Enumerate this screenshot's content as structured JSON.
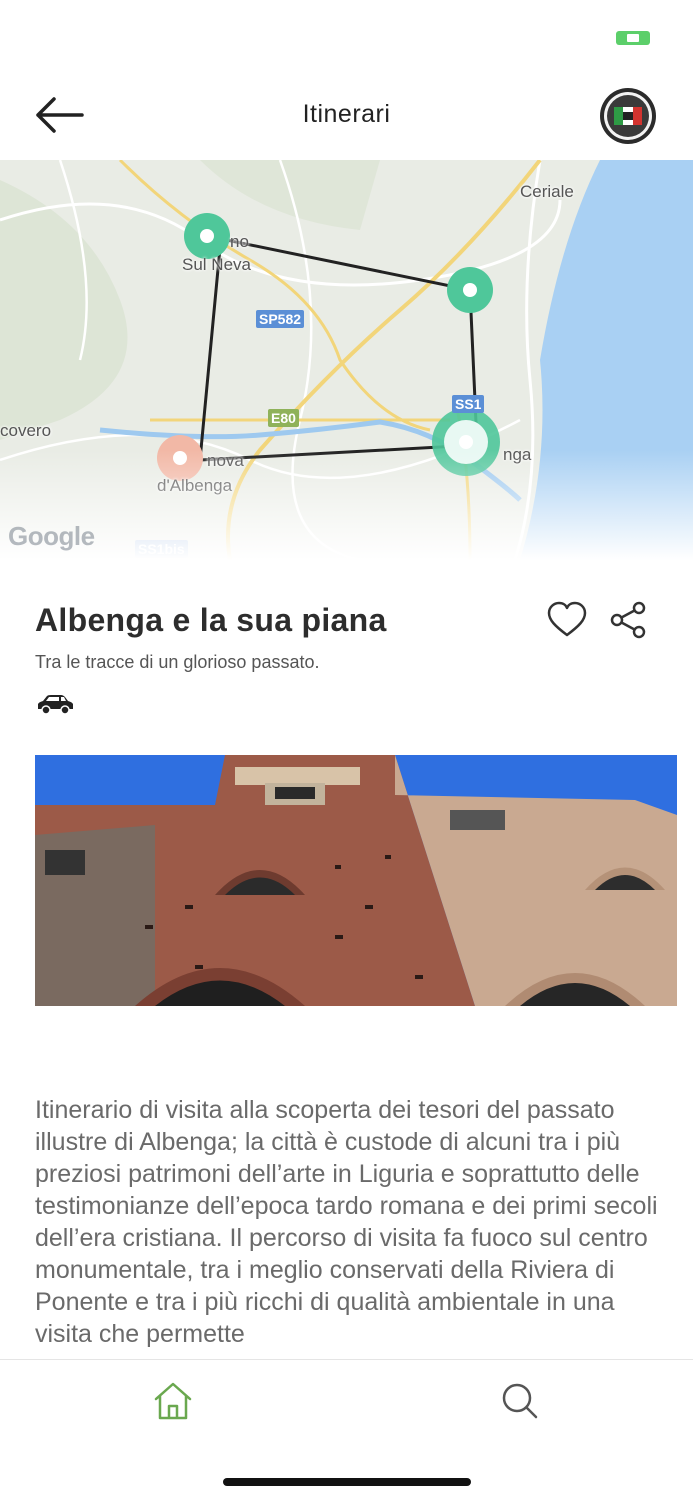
{
  "header": {
    "title": "Itinerari",
    "back_icon": "arrow-left-icon",
    "logo_icon": "italian-flag-logo-icon"
  },
  "status_bar": {
    "battery_icon": "battery-icon",
    "battery_color": "#5ccf6a"
  },
  "map": {
    "labels": {
      "ceriale": "Ceriale",
      "sul_neva": "Sul Neva",
      "no": "no",
      "covero": "covero",
      "nova": "nova",
      "dalbenga": "d'Albenga",
      "nga": "nga"
    },
    "roads": {
      "sp582": "SP582",
      "e80": "E80",
      "ss1": "SS1",
      "ss1bis": "SS1bis"
    },
    "watermark": "Google",
    "marker_color": "#4fc79a",
    "start_marker_color": "#f2b8a6"
  },
  "route": {
    "title": "Albenga e la sua piana",
    "subtitle": "Tra le tracce di un glorioso passato.",
    "transport_icon": "car-icon",
    "favorite_icon": "heart-icon",
    "share_icon": "share-icon",
    "description": "Itinerario di visita alla scoperta dei tesori del passato illustre di Albenga; la città è custode di alcuni tra i più preziosi patrimoni dell’arte in Liguria e soprattutto delle testimonianze dell’epoca tardo romana e dei primi secoli dell’era cristiana. Il percorso di visita fa fuoco sul centro monumentale, tra i meglio conservati della Riviera di Ponente e tra i più ricchi di qualità ambientale in una visita che permette"
  },
  "tabbar": {
    "home_icon": "home-icon",
    "search_icon": "search-icon",
    "active_color": "#6aa84f"
  }
}
